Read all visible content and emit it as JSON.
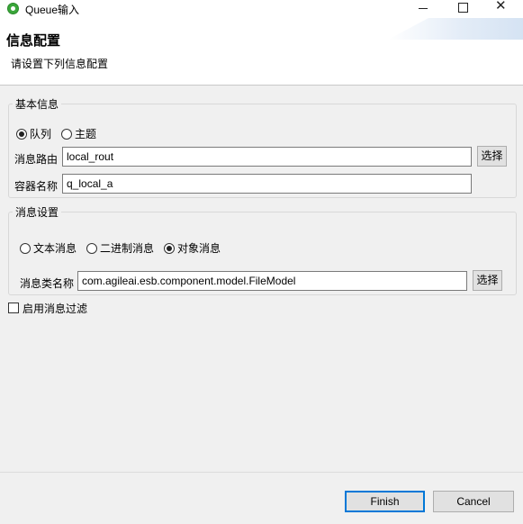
{
  "window": {
    "title": "Queue输入",
    "controls": {
      "minimize_icon": "minimize-icon",
      "maximize_icon": "maximize-icon",
      "close_icon": "close-icon"
    }
  },
  "header": {
    "title": "信息配置",
    "description": "请设置下列信息配置"
  },
  "basic_info": {
    "legend": "基本信息",
    "type_options": [
      {
        "label": "队列",
        "checked": true
      },
      {
        "label": "主题",
        "checked": false
      }
    ],
    "route_label": "消息路由",
    "route_value": "local_rout",
    "route_select_label": "选择",
    "container_label": "容器名称",
    "container_value": "q_local_a"
  },
  "message_settings": {
    "legend": "消息设置",
    "message_types": [
      {
        "label": "文本消息",
        "checked": false
      },
      {
        "label": "二进制消息",
        "checked": false
      },
      {
        "label": "对象消息",
        "checked": true
      }
    ],
    "class_label": "消息类名称",
    "class_value": "com.agileai.esb.component.model.FileModel",
    "class_select_label": "选择"
  },
  "filter": {
    "label": "启用消息过滤",
    "checked": false
  },
  "footer": {
    "finish_label": "Finish",
    "cancel_label": "Cancel"
  },
  "colors": {
    "background": "#f0f0f0",
    "default_button_border": "#0078d7",
    "app_icon": "#3aa63a"
  }
}
